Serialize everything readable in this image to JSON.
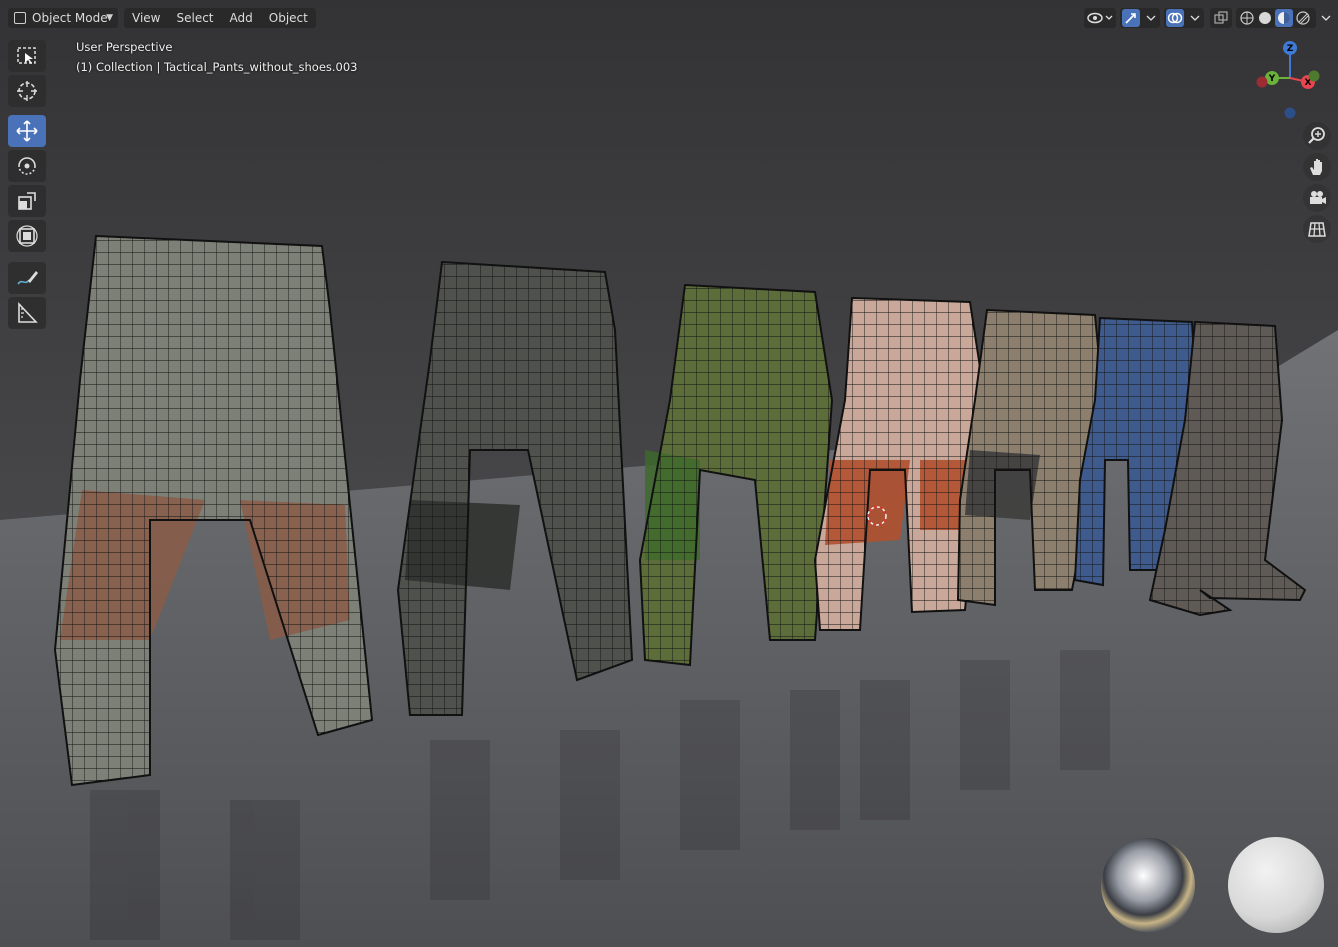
{
  "header": {
    "mode_label": "Object Mode",
    "menu": [
      "View",
      "Select",
      "Add",
      "Object"
    ]
  },
  "overlay": {
    "perspective": "User Perspective",
    "collection": "(1) Collection | Tactical_Pants_without_shoes.003"
  },
  "gizmo": {
    "z": "Z",
    "y": "Y",
    "x": "X"
  },
  "toolbar": [
    "select-box",
    "cursor",
    "move",
    "rotate",
    "scale",
    "transform",
    "annotate",
    "measure"
  ],
  "nav": [
    "zoom",
    "hand-pan",
    "camera",
    "ortho-grid"
  ],
  "colors": {
    "accent": "#4a72b8",
    "gizmo_x": "#e8454f",
    "gizmo_y": "#6bb23a",
    "gizmo_z": "#3f79d6"
  }
}
